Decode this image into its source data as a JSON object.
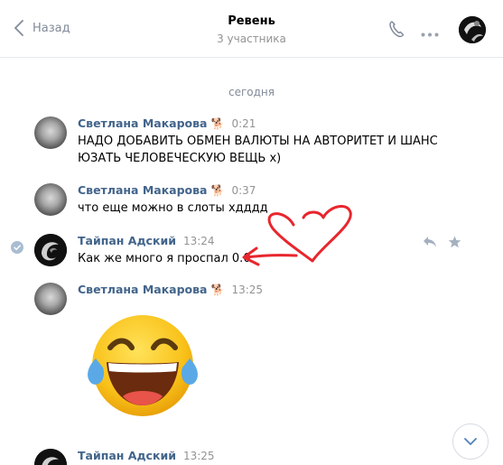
{
  "header": {
    "back_label": "Назад",
    "title": "Ревень",
    "subtitle": "3 участника"
  },
  "feed": {
    "cut_off_text": "(...)",
    "date_separator": "сегодня",
    "messages": [
      {
        "author": "Светлана Макарова",
        "emoji": "🐕",
        "time": "0:21",
        "lines": [
          "НАДО ДОБАВИТЬ ОБМЕН ВАЛЮТЫ НА АВТОРИТЕТ И ШАНС",
          "ЮЗАТЬ ЧЕЛОВЕЧЕСКУЮ ВЕЩЬ х)"
        ]
      },
      {
        "author": "Светлана Макарова",
        "emoji": "🐕",
        "time": "0:37",
        "lines": [
          "что еще можно в слоты хдддд"
        ]
      },
      {
        "author": "Тайпан Адский",
        "time": "13:24",
        "lines": [
          "Как же много я проспал 0.0"
        ]
      },
      {
        "author": "Светлана Макарова",
        "emoji": "🐕",
        "time": "13:25",
        "sticker": "laughing-crying-emoji"
      },
      {
        "author": "Тайпан Адский",
        "time": "13:25"
      }
    ]
  },
  "colors": {
    "author": "#42648b",
    "muted": "#939393",
    "annotation_red": "#e8262d"
  }
}
